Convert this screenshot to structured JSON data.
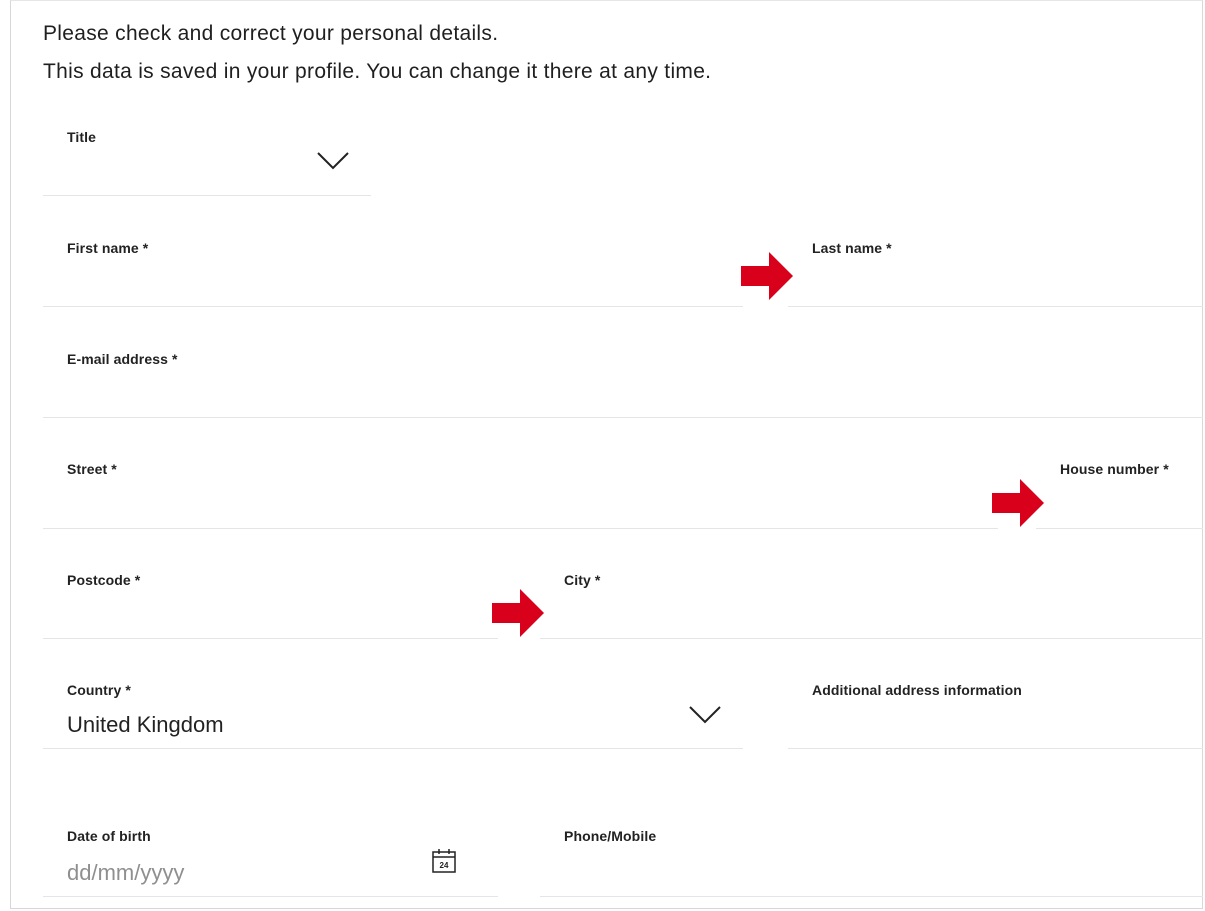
{
  "intro": {
    "line1": "Please check and correct your personal details.",
    "line2": "This data is saved in your profile. You can change it there at any time."
  },
  "fields": {
    "title": {
      "label": "Title",
      "value": ""
    },
    "first_name": {
      "label": "First name *",
      "value": ""
    },
    "last_name": {
      "label": "Last name *",
      "value": ""
    },
    "email": {
      "label": "E-mail address *",
      "value": ""
    },
    "street": {
      "label": "Street *",
      "value": ""
    },
    "house_number": {
      "label": "House number *",
      "value": ""
    },
    "postcode": {
      "label": "Postcode *",
      "value": ""
    },
    "city": {
      "label": "City *",
      "value": ""
    },
    "country": {
      "label": "Country *",
      "value": "United Kingdom"
    },
    "additional_address": {
      "label": "Additional address information",
      "value": ""
    },
    "date_of_birth": {
      "label": "Date of birth",
      "placeholder": "dd/mm/yyyy",
      "calendar_day": "24"
    },
    "phone": {
      "label": "Phone/Mobile",
      "value": ""
    }
  },
  "icons": {
    "dropdown": "chevron-down-icon",
    "calendar": "calendar-icon",
    "annotation": "red-arrow-icon"
  },
  "colors": {
    "annotation_arrow": "#d9001b",
    "underline": "#e5e5e5",
    "placeholder": "#8f8f8f"
  }
}
